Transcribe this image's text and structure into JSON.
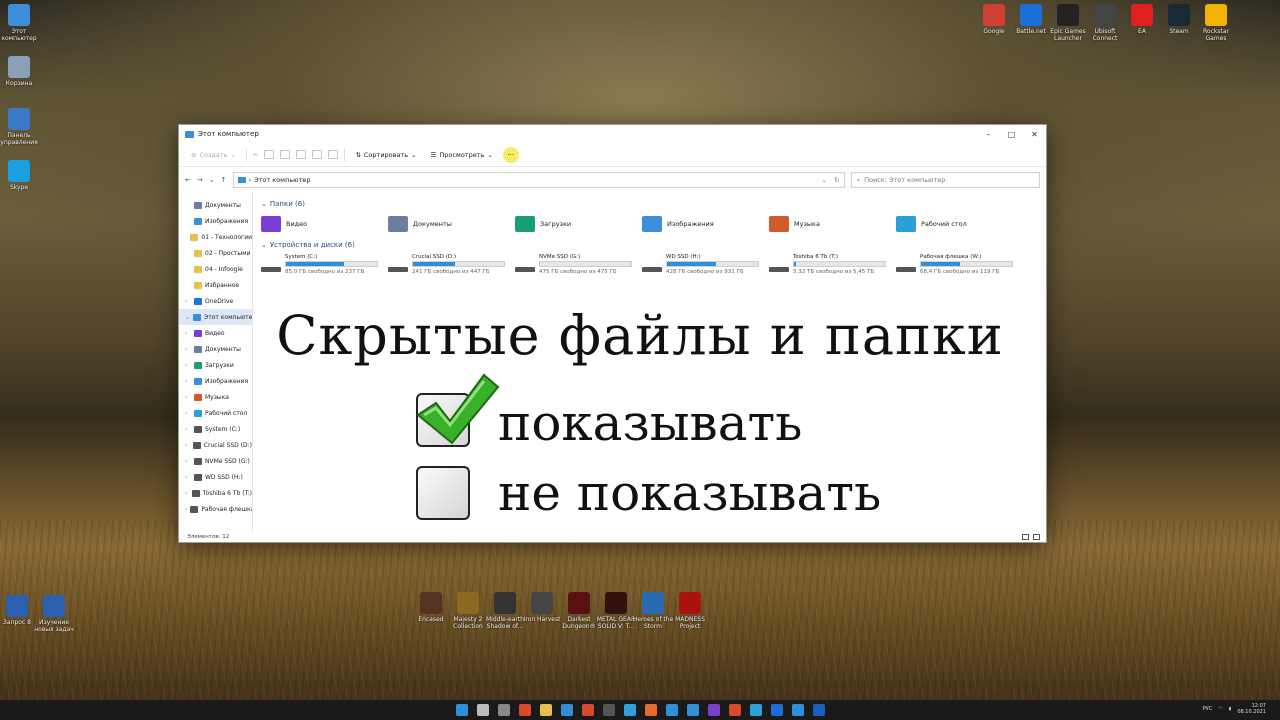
{
  "desktop": {
    "left_icons": [
      {
        "label": "Этот компьютер",
        "color": "#3a8fd8"
      },
      {
        "label": "Корзина",
        "color": "#8aa0b8"
      },
      {
        "label": "Панель управления",
        "color": "#3a78c8"
      },
      {
        "label": "Skype",
        "color": "#1aa0e0"
      }
    ],
    "top_right_icons": [
      {
        "label": "Google",
        "color": "#d04030"
      },
      {
        "label": "Battle.net",
        "color": "#1a6fd8"
      },
      {
        "label": "Epic Games Launcher",
        "color": "#222222"
      },
      {
        "label": "Ubisoft Connect",
        "color": "#444444"
      },
      {
        "label": "EA",
        "color": "#e02020"
      },
      {
        "label": "Steam",
        "color": "#1b2838"
      },
      {
        "label": "Rockstar Games",
        "color": "#f2b400"
      }
    ],
    "bottom_left_icons": [
      {
        "label": "Запрос 8",
        "color": "#2b5fb0"
      },
      {
        "label": "Изучение новых задач",
        "color": "#2b5fb0"
      }
    ],
    "game_icons": [
      {
        "label": "Encased",
        "color": "#553322"
      },
      {
        "label": "Majesty 2 Collection",
        "color": "#8a6a22"
      },
      {
        "label": "Middle-earth Shadow of...",
        "color": "#333333"
      },
      {
        "label": "Iron Harvest",
        "color": "#444444"
      },
      {
        "label": "Darkest Dungeon®",
        "color": "#5a1010"
      },
      {
        "label": "METAL GEAR SOLID V: T...",
        "color": "#331111"
      },
      {
        "label": "Heroes of the Storm",
        "color": "#2a6ab0"
      },
      {
        "label": "MADNESS Project",
        "color": "#aa1111"
      }
    ]
  },
  "window": {
    "title": "Этот компьютер",
    "controls": {
      "minimize": "–",
      "maximize": "□",
      "close": "✕"
    },
    "toolbar": {
      "create": "Создать",
      "sort": "Сортировать",
      "view": "Просмотреть",
      "more": "···"
    },
    "address": {
      "path": "Этот компьютер",
      "search_placeholder": "Поиск: Этот компьютер"
    },
    "nav": [
      {
        "label": "Документы",
        "color": "#6a7fa0",
        "arrow": ""
      },
      {
        "label": "Изображения",
        "color": "#3a8fd8",
        "arrow": ""
      },
      {
        "label": "01 - Технологии",
        "color": "#e8c14a",
        "arrow": ""
      },
      {
        "label": "02 - Простыми",
        "color": "#e8c14a",
        "arrow": ""
      },
      {
        "label": "04 - Infoogle",
        "color": "#e8c14a",
        "arrow": ""
      },
      {
        "label": "Избранное",
        "color": "#e8c14a",
        "arrow": ""
      },
      {
        "label": "OneDrive",
        "color": "#1a78d8",
        "arrow": "›"
      },
      {
        "label": "Этот компьютер",
        "color": "#3a8fd8",
        "arrow": "⌄",
        "selected": true
      },
      {
        "label": "Видео",
        "color": "#7a3fd0",
        "arrow": "›"
      },
      {
        "label": "Документы",
        "color": "#6a7fa0",
        "arrow": "›"
      },
      {
        "label": "Загрузки",
        "color": "#1aa070",
        "arrow": "›"
      },
      {
        "label": "Изображения",
        "color": "#3a8fd8",
        "arrow": "›"
      },
      {
        "label": "Музыка",
        "color": "#d05a2a",
        "arrow": "›"
      },
      {
        "label": "Рабочий стол",
        "color": "#2a9fd8",
        "arrow": "›"
      },
      {
        "label": "System (C:)",
        "color": "#555555",
        "arrow": "›"
      },
      {
        "label": "Crucial SSD (D:)",
        "color": "#555555",
        "arrow": "›"
      },
      {
        "label": "NVMe SSD (G:)",
        "color": "#555555",
        "arrow": "›"
      },
      {
        "label": "WD SSD (H:)",
        "color": "#555555",
        "arrow": "›"
      },
      {
        "label": "Toshiba 6 Tb (T:)",
        "color": "#555555",
        "arrow": "›"
      },
      {
        "label": "Рабочая флешка",
        "color": "#555555",
        "arrow": "›"
      }
    ],
    "folders_header": "Папки (6)",
    "folders": [
      {
        "label": "Видео",
        "color": "#7a3fd0"
      },
      {
        "label": "Документы",
        "color": "#6a7fa0"
      },
      {
        "label": "Загрузки",
        "color": "#1aa070"
      },
      {
        "label": "Изображения",
        "color": "#3a8fd8"
      },
      {
        "label": "Музыка",
        "color": "#d05a2a"
      },
      {
        "label": "Рабочий стол",
        "color": "#2a9fd8"
      }
    ],
    "drives_header": "Устройства и диски (6)",
    "drives": [
      {
        "label": "System (C:)",
        "free": "85,0 ГБ свободно из 237 ГБ",
        "used": 0.64
      },
      {
        "label": "Crucial SSD (D:)",
        "free": "241 ГБ свободно из 447 ГБ",
        "used": 0.46
      },
      {
        "label": "NVMe SSD (G:)",
        "free": "475 ГБ свободно из 475 ГБ",
        "used": 0.0
      },
      {
        "label": "WD SSD (H:)",
        "free": "428 ГБ свободно из 931 ГБ",
        "used": 0.54
      },
      {
        "label": "Toshiba 6 Tb (T:)",
        "free": "5,32 ТБ свободно из 5,45 ТБ",
        "used": 0.02
      },
      {
        "label": "Рабочая флешка (W:)",
        "free": "68,4 ГБ свободно из 119 ГБ",
        "used": 0.43
      }
    ],
    "status": "Элементов: 12"
  },
  "overlay": {
    "title": "Скрытые файлы и папки",
    "show": "показывать",
    "hide": "не показывать"
  },
  "taskbar": {
    "time": "12:07",
    "date": "08.10.2021",
    "lang": "РУС"
  }
}
